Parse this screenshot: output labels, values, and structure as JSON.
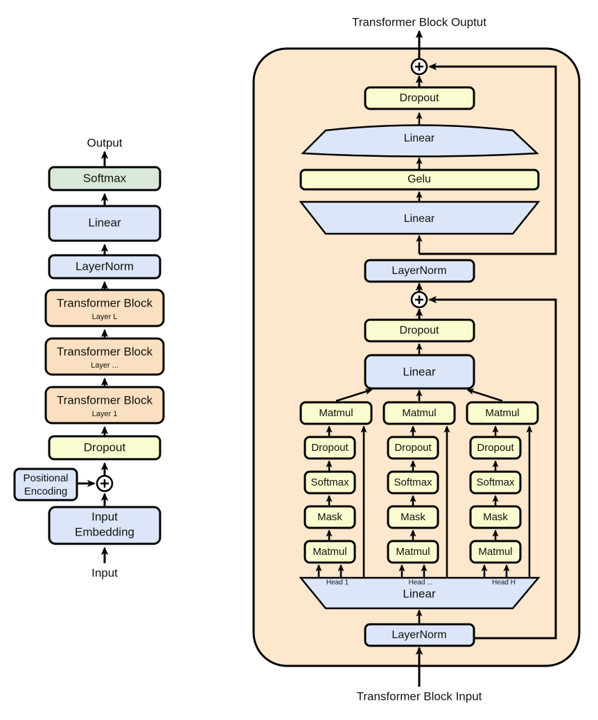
{
  "colors": {
    "blue": "#dce6f8",
    "yellow": "#fbfbd0",
    "green": "#d9e8d8",
    "orange_box": "#fadfc0",
    "panel_bg": "#fde8cd",
    "stroke": "#000000",
    "text": "#111111",
    "page_bg": "#ffffff"
  },
  "left_column": {
    "top_label": "Output",
    "bottom_label": "Input",
    "nodes": [
      {
        "label": "Softmax",
        "sub": "",
        "color": "green"
      },
      {
        "label": "Linear",
        "sub": "",
        "color": "blue"
      },
      {
        "label": "LayerNorm",
        "sub": "",
        "color": "blue"
      },
      {
        "label": "Transformer Block",
        "sub": "Layer L",
        "color": "orange_box"
      },
      {
        "label": "Transformer Block",
        "sub": "Layer ...",
        "color": "orange_box"
      },
      {
        "label": "Transformer Block",
        "sub": "Layer 1",
        "color": "orange_box"
      },
      {
        "label": "Dropout",
        "sub": "",
        "color": "yellow"
      },
      {
        "label": "Input Embedding",
        "sub": "",
        "color": "blue"
      }
    ],
    "positional_encoding": {
      "line1": "Positional",
      "line2": "Encoding",
      "color": "blue"
    },
    "add_symbol": "+"
  },
  "right_panel": {
    "top_label": "Transformer Block Ouptut",
    "bottom_label": "Transformer Block Input",
    "add_symbol": "+",
    "ffn": {
      "dropout": "Dropout",
      "linear_out": "Linear",
      "gelu": "Gelu",
      "linear_in": "Linear"
    },
    "mid_layernorm": "LayerNorm",
    "attention": {
      "dropout": "Dropout",
      "proj_linear": "Linear",
      "qkv_linear": "Linear",
      "input_layernorm": "LayerNorm",
      "head_labels": [
        "Head 1",
        "Head ...",
        "Head H"
      ],
      "head_stack": [
        "Matmul",
        "Dropout",
        "Softmax",
        "Mask",
        "Matmul"
      ]
    }
  }
}
